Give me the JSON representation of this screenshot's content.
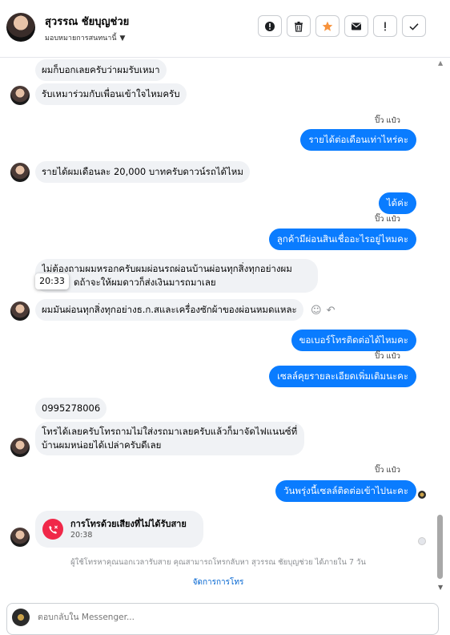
{
  "header": {
    "contact_name": "สุวรรณ ชัยบุญช่วย",
    "assign_label": "มอบหมายการสนทนานี้",
    "buttons": [
      {
        "name": "alert-icon"
      },
      {
        "name": "trash-icon"
      },
      {
        "name": "star-icon"
      },
      {
        "name": "envelope-icon"
      },
      {
        "name": "exclamation-icon"
      },
      {
        "name": "check-icon"
      }
    ],
    "star_color": "#f7923b"
  },
  "messages": {
    "m1": "ผมก็บอกเลยครับว่าผมรับเหมา",
    "m2": "รับเหมาร่วมกับเพื่อนเข้าใจไหมครับ",
    "sender1": "ปิ๊ว แป๋ว",
    "m3": "รายได้ต่อเดือนเท่าไหร่คะ",
    "m4": "รายได้ผมเดือนละ 20,000 บาทครับดาวน์รถได้ไหม",
    "m5": "ได้ค่ะ",
    "sender2": "ปิ๊ว แป๋ว",
    "m6": "ลูกค้ามีผ่อนสินเชื่ออะไรอยู่ไหมคะ",
    "m7a": "ไม่ต้องถามผมหรอกครับผมผ่อนรถผ่อนบ้านผ่อนทุกสิ่งทุกอย่างผม",
    "m7b": "ดถ้าจะให้ผมดาวก็ส่งเงินมารถมาเลย",
    "tooltip": "20:33",
    "m8": "ผมมันผ่อนทุกสิ่งทุกอย่างธ.ก.สและเครื่องซักผ้าของผ่อนหมดแหละ",
    "m9": "ขอเบอร์โทรติดต่อได้ไหมคะ",
    "sender3": "ปิ๊ว แป๋ว",
    "m10": "เซลล์คุยรายละเอียดเพิ่มเติมนะคะ",
    "m11": "0995278006",
    "m12a": "โทรได้เลยครับโทรถามไม่ใส่งรถมาเลยครับแล้วก็มาจัดไฟแนนซ์ที่",
    "m12b": "บ้านผมหน่อยได้เปล่าครับดีเลย",
    "sender4": "ปิ๊ว แป๋ว",
    "m13": "วันพรุ่งนี้เซลล์ติดต่อเข้าไปนะคะ",
    "call_title": "การโทรด้วยเสียงที่ไม่ได้รับสาย",
    "call_time": "20:38",
    "notice": "ผู้ใช้โทรหาคุณนอกเวลารับสาย คุณสามารถโทรกลับหา สุวรรณ ชัยบุญช่วย ได้ภายใน 7 วัน",
    "manage_calls": "จัดการการโทร"
  },
  "reply": {
    "placeholder": "ตอบกลับใน Messenger..."
  },
  "colors": {
    "outgoing": "#0a7cff",
    "incoming": "#f0f2f5",
    "missed_call": "#f02849",
    "link": "#0064d1"
  }
}
